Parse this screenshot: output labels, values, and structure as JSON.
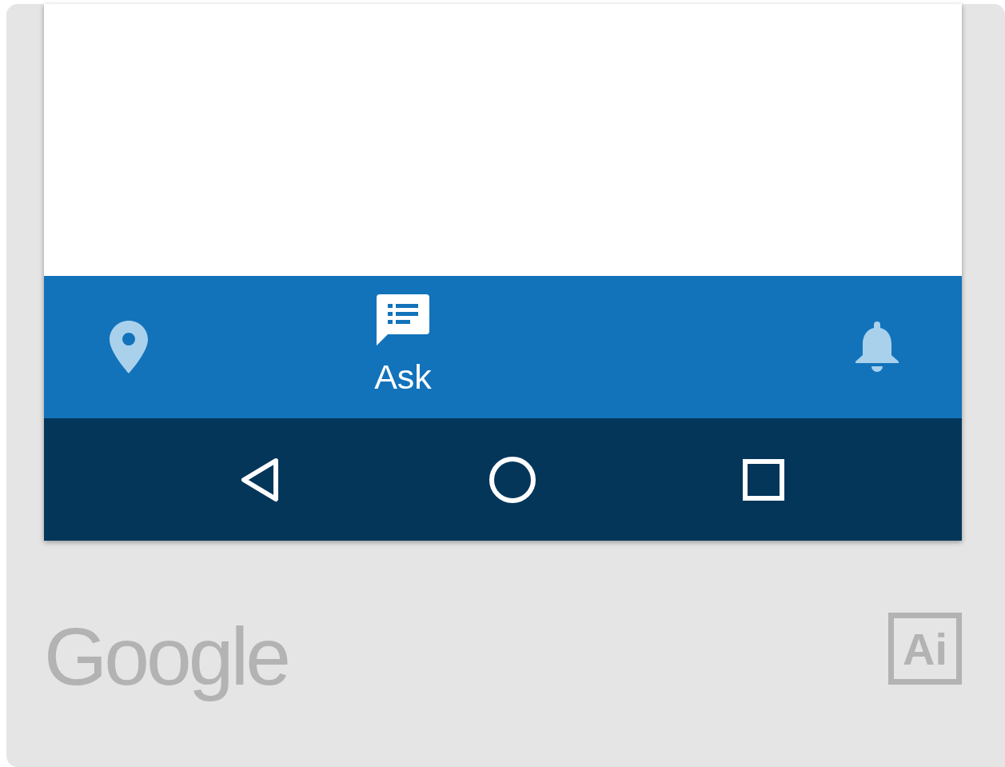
{
  "bottom_navigation": [
    {
      "kind": "location",
      "selected": false
    },
    {
      "kind": "ask",
      "label": "Ask",
      "selected": true
    },
    {
      "kind": "bell",
      "selected": false
    }
  ],
  "system_navigation": [
    {
      "kind": "back"
    },
    {
      "kind": "home"
    },
    {
      "kind": "recents"
    }
  ],
  "footer": {
    "logo": "Google",
    "badge": "Ai"
  }
}
